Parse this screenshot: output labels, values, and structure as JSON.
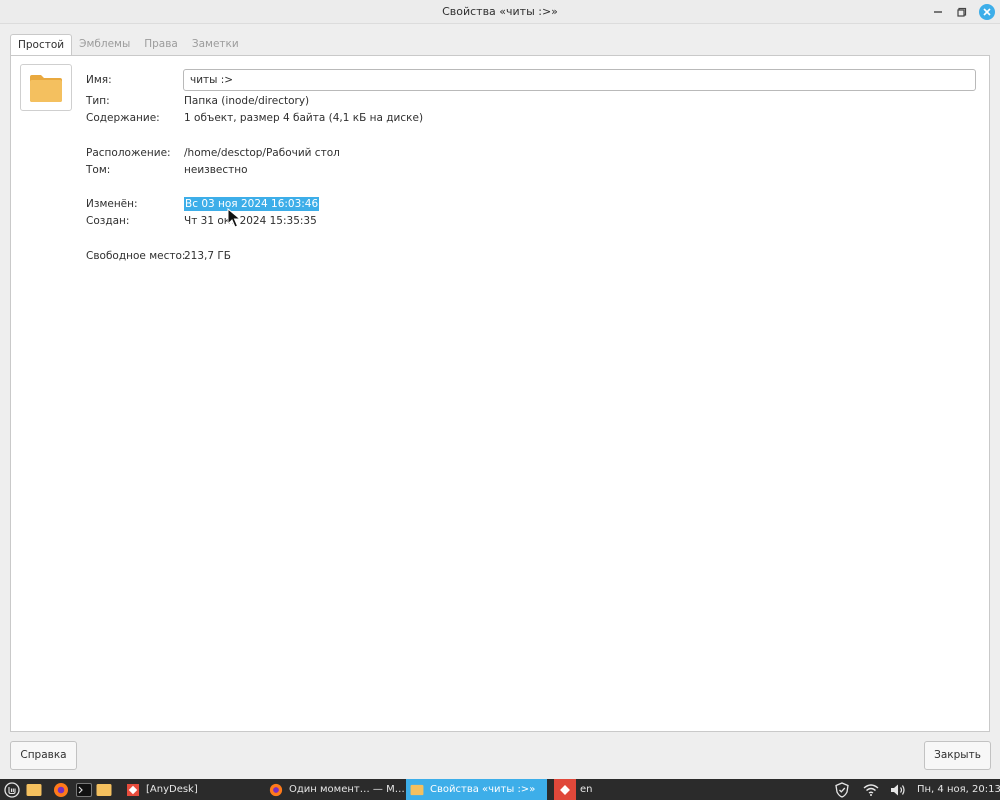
{
  "window": {
    "title": "Свойства «читы  :>»"
  },
  "tabs": [
    {
      "label": "Простой",
      "active": true
    },
    {
      "label": "Эмблемы",
      "active": false
    },
    {
      "label": "Права",
      "active": false
    },
    {
      "label": "Заметки",
      "active": false
    }
  ],
  "basic": {
    "name_label": "Имя:",
    "name_value": "читы  :>",
    "type_label": "Тип:",
    "type_value": "Папка (inode/directory)",
    "contents_label": "Содержание:",
    "contents_value": "1 объект, размер 4 байта (4,1 кБ на диске)",
    "location_label": "Расположение:",
    "location_value": "/home/desctop/Рабочий стол",
    "volume_label": "Том:",
    "volume_value": "неизвестно",
    "modified_label": "Изменён:",
    "modified_value": "Вс 03 ноя 2024 16:03:46",
    "created_label": "Создан:",
    "created_value": "Чт 31 окт 2024 15:35:35",
    "free_label": "Свободное место:",
    "free_value": "213,7 ГБ"
  },
  "buttons": {
    "help": "Справка",
    "close": "Закрыть"
  },
  "taskbar": {
    "tasks": [
      {
        "label": "[AnyDesk]",
        "icon": "anydesk-icon"
      },
      {
        "label": "Один момент… — M…",
        "icon": "firefox-icon"
      },
      {
        "label": "Свойства «читы  :>»",
        "icon": "folder-icon",
        "active": true
      }
    ],
    "lang": "en",
    "clock": "Пн, 4 ноя, 20:13"
  },
  "colors": {
    "accent": "#3daee9",
    "folder": "#f4c05f",
    "taskbar": "#2b2b2b"
  }
}
